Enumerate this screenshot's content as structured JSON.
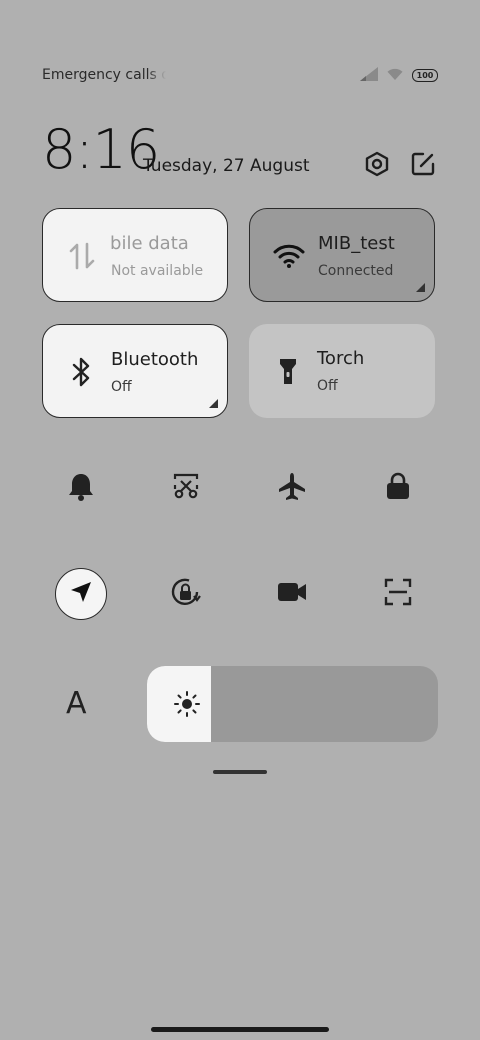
{
  "status_bar": {
    "carrier_text": "Emergency calls o",
    "battery_level": "100",
    "icons": [
      "signal-icon",
      "wifi-icon",
      "battery-icon"
    ]
  },
  "header": {
    "time": "8:16",
    "date": "Tuesday, 27 August",
    "icons": [
      "settings-icon",
      "edit-icon"
    ]
  },
  "tiles": {
    "mobile_data": {
      "title": "obile data",
      "subtitle": "Not available",
      "icon": "data-arrows-icon",
      "state": "unavailable"
    },
    "wifi": {
      "title": "MIB_test",
      "subtitle": "Connected",
      "icon": "wifi-icon",
      "state": "on"
    },
    "bluetooth": {
      "title": "Bluetooth",
      "subtitle": "Off",
      "icon": "bluetooth-icon",
      "state": "off"
    },
    "torch": {
      "title": "Torch",
      "subtitle": "Off",
      "icon": "torch-icon",
      "state": "off"
    }
  },
  "quick_toggles_row1": [
    "bell-icon",
    "screenshot-icon",
    "airplane-icon",
    "lock-icon"
  ],
  "quick_toggles_row2": [
    "location-icon",
    "rotation-lock-icon",
    "video-camera-icon",
    "scanner-icon"
  ],
  "location_active": true,
  "font_size_label": "A",
  "brightness": {
    "level_percent": 22
  },
  "colors": {
    "background": "#b0b0b0",
    "tile_light": "#f3f3f3",
    "tile_active": "#9a9a9a",
    "tile_soft": "#c4c4c4"
  }
}
